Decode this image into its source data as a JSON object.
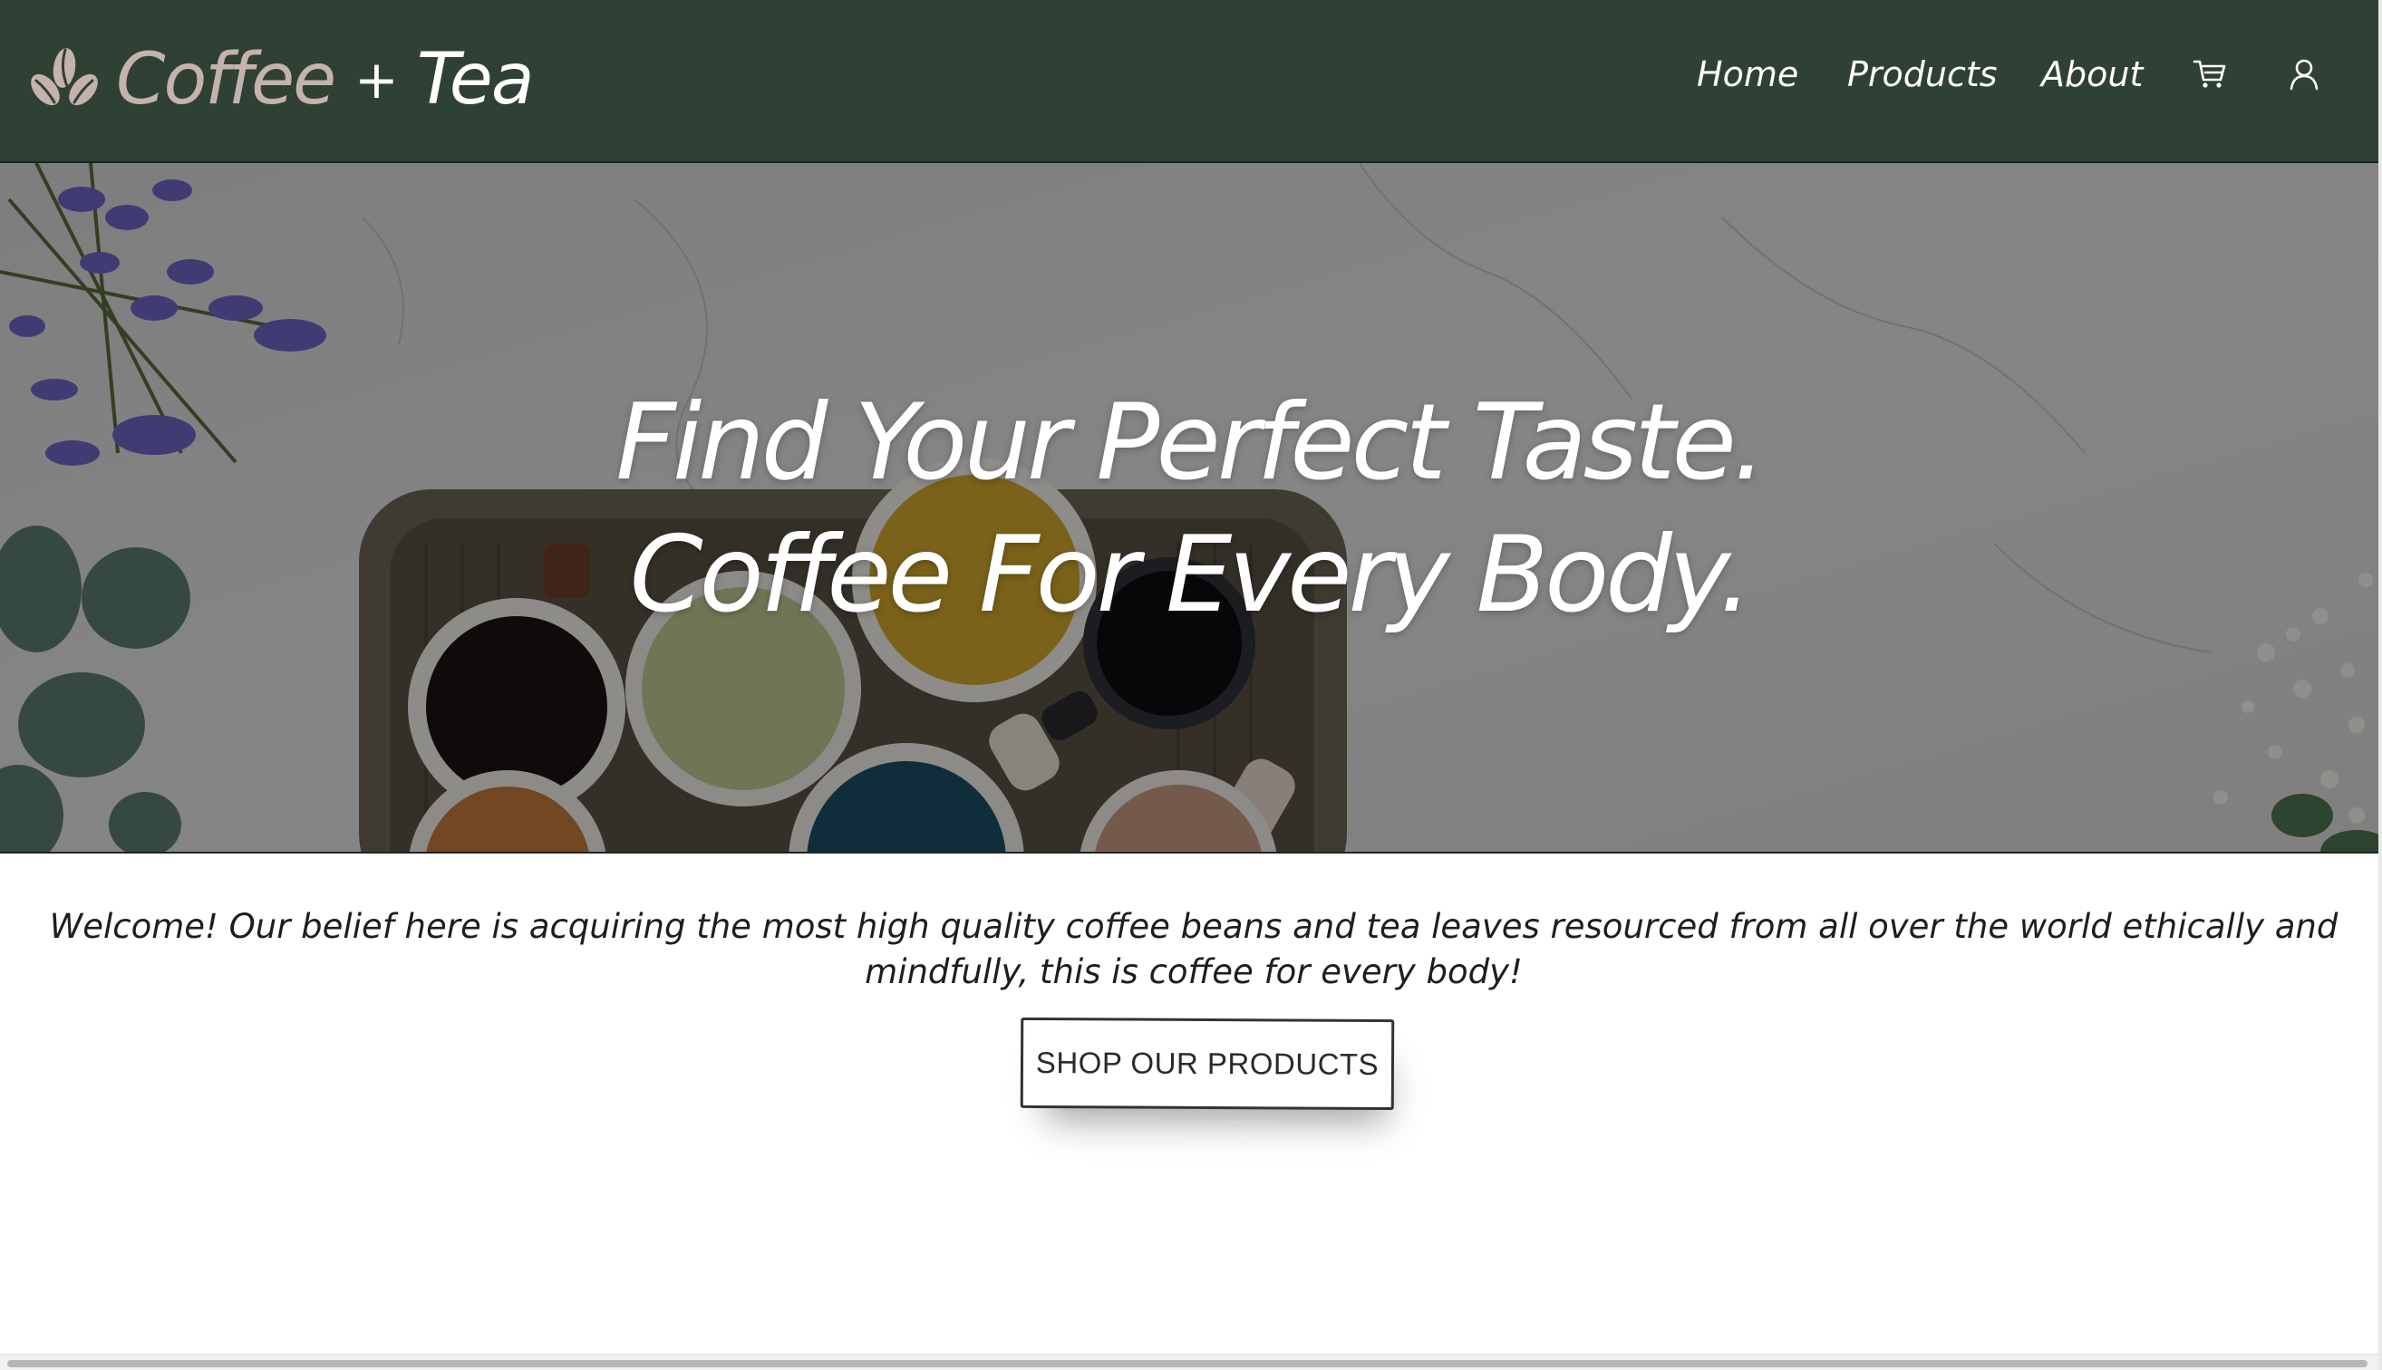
{
  "brand": {
    "word1": "Coffee",
    "plus": "+",
    "word2": "Tea",
    "icon": "coffee-bean-leaf-icon"
  },
  "nav": {
    "home": "Home",
    "products": "Products",
    "about": "About",
    "cart_icon": "cart-icon",
    "user_icon": "user-icon"
  },
  "hero": {
    "line1": "Find Your Perfect Taste.",
    "line2": "Coffee For Every Body."
  },
  "welcome": {
    "text": "Welcome! Our belief here is acquiring the most high quality coffee beans and tea leaves resourced from all over the world ethically and mindfully, this is coffee for every body!"
  },
  "cta": {
    "label": "SHOP OUR PRODUCTS"
  },
  "colors": {
    "navbar": "#2f4034",
    "brand_coffee": "#c4b2ad",
    "text_light": "#ffffff"
  }
}
